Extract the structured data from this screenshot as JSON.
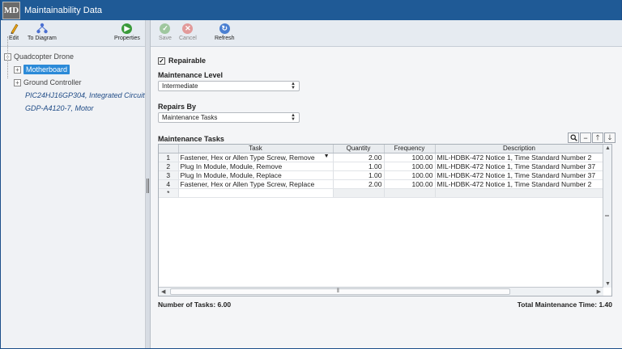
{
  "window": {
    "title": "Maintainability Data",
    "logo": "MD"
  },
  "left_toolbar": [
    {
      "label": "Edit",
      "icon": "pencil-icon"
    },
    {
      "label": "To Diagram",
      "icon": "diagram-icon"
    },
    {
      "label": "Properties",
      "icon": "play-icon"
    }
  ],
  "tree": {
    "root": "Quadcopter Drone",
    "items": [
      {
        "label": "Motherboard",
        "selected": true
      },
      {
        "label": "Ground Controller"
      },
      {
        "label": "PIC24HJ16GP304, Integrated Circuit"
      },
      {
        "label": "GDP-A4120-7, Motor"
      }
    ]
  },
  "right_toolbar": [
    {
      "label": "Save",
      "icon": "check-icon",
      "enabled": false
    },
    {
      "label": "Cancel",
      "icon": "cancel-icon",
      "enabled": false
    },
    {
      "label": "Refresh",
      "icon": "refresh-icon",
      "enabled": true
    }
  ],
  "form": {
    "repairable_label": "Repairable",
    "repairable_checked": true,
    "maintenance_level_label": "Maintenance Level",
    "maintenance_level_value": "Intermediate",
    "repairs_by_label": "Repairs By",
    "repairs_by_value": "Maintenance Tasks",
    "tasks_label": "Maintenance Tasks"
  },
  "table": {
    "columns": [
      "Task",
      "Quantity",
      "Frequency",
      "Description"
    ],
    "rows": [
      {
        "n": "1",
        "task": "Fastener, Hex or Allen Type Screw, Remove",
        "quantity": "2.00",
        "frequency": "100.00",
        "description": "MIL-HDBK-472 Notice 1, Time Standard Number 2"
      },
      {
        "n": "2",
        "task": "Plug In Module, Module, Remove",
        "quantity": "1.00",
        "frequency": "100.00",
        "description": "MIL-HDBK-472 Notice 1, Time Standard Number 37"
      },
      {
        "n": "3",
        "task": "Plug In Module, Module, Replace",
        "quantity": "1.00",
        "frequency": "100.00",
        "description": "MIL-HDBK-472 Notice 1, Time Standard Number 37"
      },
      {
        "n": "4",
        "task": "Fastener, Hex or Allen Type Screw, Replace",
        "quantity": "2.00",
        "frequency": "100.00",
        "description": "MIL-HDBK-472 Notice 1, Time Standard Number 2"
      }
    ],
    "new_row_marker": "*"
  },
  "footer": {
    "tasks_count": "Number of Tasks: 6.00",
    "total_time": "Total Maintenance Time: 1.40"
  },
  "colors": {
    "titlebar": "#1f5a96",
    "selection": "#2b8ad8"
  }
}
